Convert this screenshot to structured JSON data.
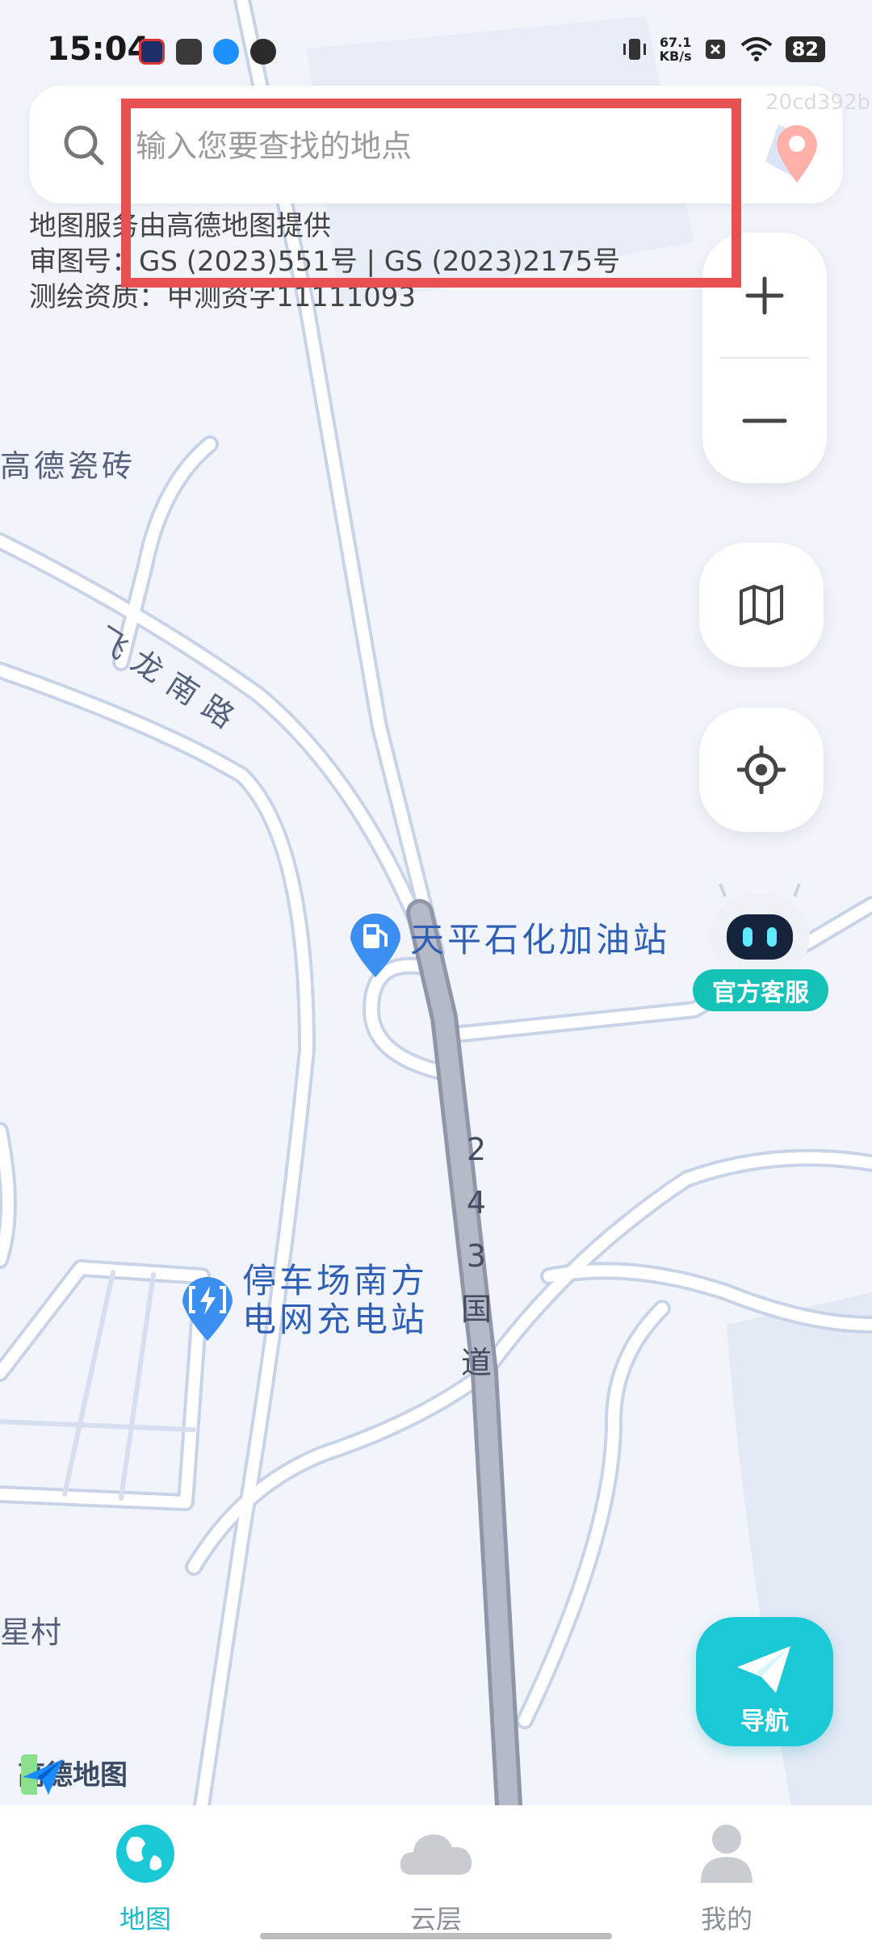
{
  "status": {
    "time": "15:04",
    "net_speed_value": "67.1",
    "net_speed_unit": "KB/s",
    "battery": "82"
  },
  "search": {
    "placeholder": "输入您要查找的地点"
  },
  "map_badge": "20cd392b",
  "credits": {
    "line1": "地图服务由高德地图提供",
    "line2": "审图号：GS (2023)551号 | GS (2023)2175号",
    "line3": "测绘资质：甲测资字11111093"
  },
  "controls": {
    "zoom_in": "+",
    "zoom_out": "−",
    "customer_service": "官方客服",
    "navigate": "导航"
  },
  "map_labels": {
    "road_feilong": "飞龙南路",
    "gas_station": "天平石化加油站",
    "charging_line1": "停车场南方",
    "charging_line2": "电网充电站",
    "national_road": [
      "2",
      "4",
      "3",
      "国",
      "道"
    ],
    "tile_store": "高德瓷砖",
    "village": "星村"
  },
  "logo": "高德地图",
  "tabs": [
    {
      "label": "地图",
      "active": true
    },
    {
      "label": "云层",
      "active": false
    },
    {
      "label": "我的",
      "active": false
    }
  ],
  "colors": {
    "accent": "#1bc9d6",
    "highlight": "#e65050",
    "poi_blue": "#2f5fb5"
  }
}
